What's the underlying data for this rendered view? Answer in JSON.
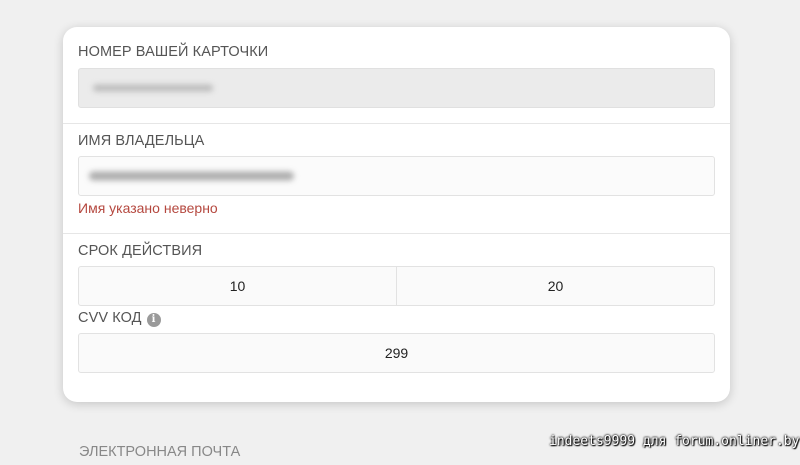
{
  "card_number": {
    "label": "НОМЕР ВАШЕЙ КАРТОЧКИ",
    "value_obscured": true
  },
  "owner_name": {
    "label": "ИМЯ ВЛАДЕЛЬЦА",
    "value_obscured": true,
    "error": "Имя указано неверно"
  },
  "expiry": {
    "label": "СРОК ДЕЙСТВИЯ",
    "month": "10",
    "year": "20"
  },
  "cvv": {
    "label": "CVV КОД",
    "info_icon": "info-icon",
    "value": "299"
  },
  "email": {
    "label": "ЭЛЕКТРОННАЯ ПОЧТА"
  },
  "watermark": "indeets9999 для forum.onliner.by",
  "colors": {
    "error": "#b5483f",
    "background": "#f0f0f0",
    "card": "#ffffff"
  }
}
